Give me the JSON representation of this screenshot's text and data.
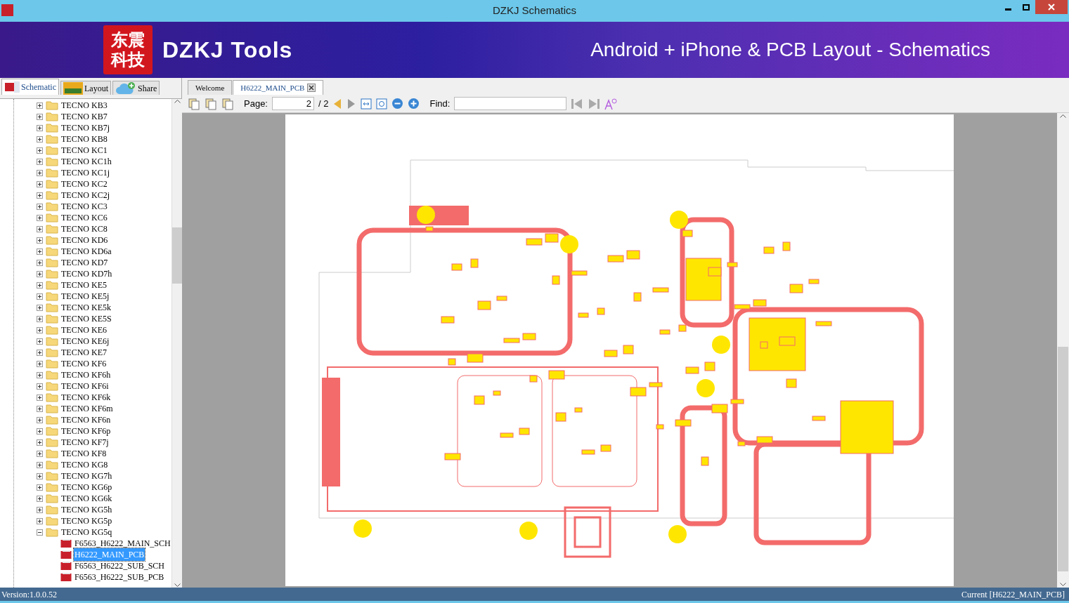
{
  "window": {
    "title": "DZKJ Schematics"
  },
  "banner": {
    "logo_text": "东震科技",
    "brand": "DZKJ Tools",
    "tagline": "Android + iPhone & PCB Layout - Schematics"
  },
  "side_tabs": [
    {
      "label": "Schematic",
      "kind": "pdf",
      "selected": true
    },
    {
      "label": "Layout",
      "kind": "pads",
      "selected": false
    },
    {
      "label": "Share",
      "kind": "cloud",
      "selected": false
    }
  ],
  "tree": [
    {
      "label": "TECNO KB3",
      "expanded": false
    },
    {
      "label": "TECNO KB7",
      "expanded": false
    },
    {
      "label": "TECNO KB7j",
      "expanded": false
    },
    {
      "label": "TECNO KB8",
      "expanded": false
    },
    {
      "label": "TECNO KC1",
      "expanded": false
    },
    {
      "label": "TECNO KC1h",
      "expanded": false
    },
    {
      "label": "TECNO KC1j",
      "expanded": false
    },
    {
      "label": "TECNO KC2",
      "expanded": false
    },
    {
      "label": "TECNO KC2j",
      "expanded": false
    },
    {
      "label": "TECNO KC3",
      "expanded": false
    },
    {
      "label": "TECNO KC6",
      "expanded": false
    },
    {
      "label": "TECNO KC8",
      "expanded": false
    },
    {
      "label": "TECNO KD6",
      "expanded": false
    },
    {
      "label": "TECNO KD6a",
      "expanded": false
    },
    {
      "label": "TECNO KD7",
      "expanded": false
    },
    {
      "label": "TECNO KD7h",
      "expanded": false
    },
    {
      "label": "TECNO KE5",
      "expanded": false
    },
    {
      "label": "TECNO KE5j",
      "expanded": false
    },
    {
      "label": "TECNO KE5k",
      "expanded": false
    },
    {
      "label": "TECNO KE5S",
      "expanded": false
    },
    {
      "label": "TECNO KE6",
      "expanded": false
    },
    {
      "label": "TECNO KE6j",
      "expanded": false
    },
    {
      "label": "TECNO KE7",
      "expanded": false
    },
    {
      "label": "TECNO KF6",
      "expanded": false
    },
    {
      "label": "TECNO KF6h",
      "expanded": false
    },
    {
      "label": "TECNO KF6i",
      "expanded": false
    },
    {
      "label": "TECNO KF6k",
      "expanded": false
    },
    {
      "label": "TECNO KF6m",
      "expanded": false
    },
    {
      "label": "TECNO KF6n",
      "expanded": false
    },
    {
      "label": "TECNO KF6p",
      "expanded": false
    },
    {
      "label": "TECNO KF7j",
      "expanded": false
    },
    {
      "label": "TECNO KF8",
      "expanded": false
    },
    {
      "label": "TECNO KG8",
      "expanded": false
    },
    {
      "label": "TECNO KG7h",
      "expanded": false
    },
    {
      "label": "TECNO KG6p",
      "expanded": false
    },
    {
      "label": "TECNO KG6k",
      "expanded": false
    },
    {
      "label": "TECNO KG5h",
      "expanded": false
    },
    {
      "label": "TECNO KG5p",
      "expanded": false
    },
    {
      "label": "TECNO KG5q",
      "expanded": true,
      "children": [
        {
          "label": "F6563_H6222_MAIN_SCH",
          "selected": false
        },
        {
          "label": "H6222_MAIN_PCB",
          "selected": true
        },
        {
          "label": "F6563_H6222_SUB_SCH",
          "selected": false
        },
        {
          "label": "F6563_H6222_SUB_PCB",
          "selected": false
        }
      ]
    }
  ],
  "doc_tabs": [
    {
      "label": "Welcome",
      "selected": false,
      "closable": false
    },
    {
      "label": "H6222_MAIN_PCB",
      "selected": true,
      "closable": true
    }
  ],
  "toolbar": {
    "page_label": "Page:",
    "page_value": "2",
    "page_total": "/ 2",
    "find_label": "Find:"
  },
  "status_bar": {
    "version": "Version:1.0.0.52",
    "current": "Current [H6222_MAIN_PCB]"
  }
}
